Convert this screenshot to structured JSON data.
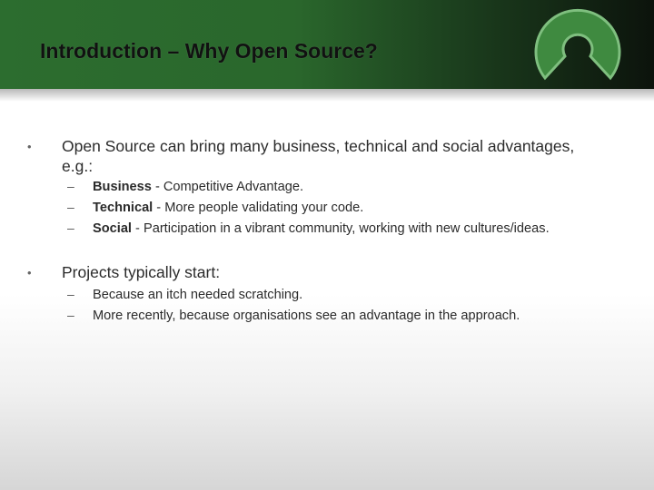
{
  "slide": {
    "title": "Introduction – Why Open Source?",
    "bullet_marker": "•",
    "dash_marker": "–",
    "points": [
      {
        "text_line1": "Open Source can bring many business, technical and social advantages,",
        "text_line2": "e.g.:",
        "subpoints": [
          {
            "bold": "Business",
            "rest": " - Competitive Advantage."
          },
          {
            "bold": "Technical",
            "rest": " - More people validating your code."
          },
          {
            "bold": "Social",
            "rest": " - Participation in a vibrant community, working with new cultures/ideas."
          }
        ]
      },
      {
        "text_line1": "Projects typically start:",
        "subpoints": [
          {
            "rest": "Because an itch needed scratching."
          },
          {
            "rest": "More recently, because organisations see an advantage in the approach."
          }
        ]
      }
    ]
  },
  "colors": {
    "header_green": "#2c6d2f",
    "logo_green": "#3f8a40"
  },
  "icons": {
    "logo": "open-source-keyhole-logo"
  }
}
